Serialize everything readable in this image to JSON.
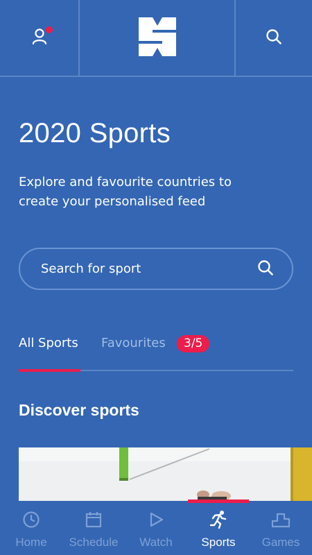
{
  "header": {
    "profile_icon": "person-icon",
    "logo_icon": "brand-logo-icon",
    "search_icon": "search-icon",
    "notification_color": "#ec1d4b"
  },
  "page": {
    "title": "2020 Sports",
    "subtitle": "Explore and favourite countries to create your personalised feed"
  },
  "search": {
    "placeholder": "Search for sport"
  },
  "tabs": {
    "all_label": "All Sports",
    "fav_label": "Favourites",
    "fav_badge": "3/5"
  },
  "section": {
    "title": "Discover sports"
  },
  "bottom_nav": {
    "items": [
      {
        "label": "Home",
        "icon": "clock-icon"
      },
      {
        "label": "Schedule",
        "icon": "calendar-icon"
      },
      {
        "label": "Watch",
        "icon": "play-icon"
      },
      {
        "label": "Sports",
        "icon": "runner-icon",
        "active": true
      },
      {
        "label": "Games",
        "icon": "podium-icon"
      }
    ]
  },
  "colors": {
    "background": "#3466b3",
    "accent": "#ec1d4b",
    "divider": "#5d86c6",
    "inactive": "#7fa0d6"
  }
}
